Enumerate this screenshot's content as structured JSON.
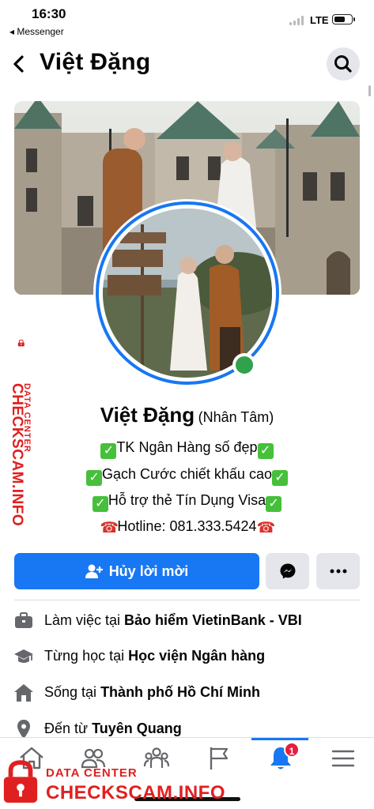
{
  "status_bar": {
    "time": "16:30",
    "back_app": "◂ Messenger",
    "network": "LTE"
  },
  "header": {
    "title": "Việt Đặng"
  },
  "profile": {
    "name": "Việt Đặng",
    "alt_name": "(Nhân Tâm)",
    "bio": [
      "TK Ngân Hàng số đẹp",
      "Gạch Cước chiết khấu cao",
      "Hỗ trợ thẻ Tín Dụng Visa",
      "Hotline: 081.333.5424"
    ]
  },
  "actions": {
    "primary_label": "Hủy lời mời"
  },
  "info": [
    {
      "prefix": "Làm việc tại ",
      "value": "Bảo hiểm VietinBank - VBI",
      "icon": "briefcase-icon"
    },
    {
      "prefix": "Từng học tại ",
      "value": "Học viện Ngân hàng",
      "icon": "graduation-cap-icon"
    },
    {
      "prefix": "Sống tại ",
      "value": "Thành phố Hồ Chí Minh",
      "icon": "home-icon"
    },
    {
      "prefix": "Đến từ ",
      "value": "Tuyên Quang",
      "icon": "location-pin-icon"
    }
  ],
  "bottom_nav": {
    "tabs": [
      "home-icon",
      "friends-icon",
      "groups-icon",
      "pages-flag-icon",
      "notifications-bell-icon",
      "menu-icon"
    ],
    "active_tab": "notifications-bell-icon",
    "notification_count": "1"
  },
  "watermark": {
    "small": "DATA CENTER",
    "big": "CHECKSCAM.INFO"
  },
  "colors": {
    "accent": "#1877f2",
    "online": "#31a24c",
    "watermark": "#e02020",
    "badge": "#e41e3f"
  }
}
